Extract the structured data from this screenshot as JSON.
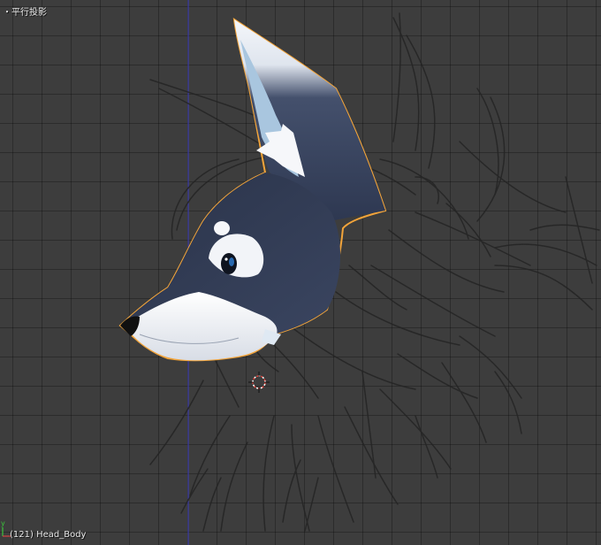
{
  "viewport": {
    "view_label": "・平行投影",
    "object_label": "(121) Head_Body",
    "axis_x": "x",
    "axis_y": "y"
  },
  "colors": {
    "background": "#3d3d3d",
    "grid_line": "#303030",
    "blue_axis": "#3f3fbf",
    "sketch": "#2a2a2a",
    "fur_dark": "#2d3750",
    "fur_white": "#f1f3f7",
    "ear_inner": "#a9c6df",
    "selection_outline": "#f2a43a",
    "cursor_red": "#e8433a"
  },
  "icons": {
    "cursor": "3d-cursor-icon"
  }
}
